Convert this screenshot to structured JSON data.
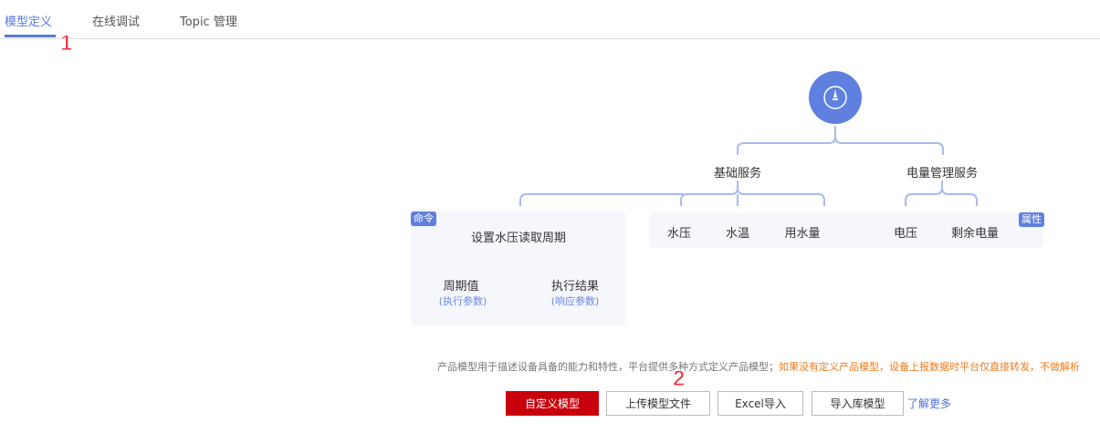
{
  "tabs": [
    {
      "label": "模型定义",
      "active": true
    },
    {
      "label": "在线调试"
    },
    {
      "label": "Topic 管理"
    }
  ],
  "annotations": [
    "1",
    "2"
  ],
  "diagram": {
    "root_icon": "compass-icon",
    "services": [
      "基础服务",
      "电量管理服务"
    ],
    "command": {
      "tag": "命令",
      "name": "设置水压读取周期",
      "params": [
        {
          "name": "周期值",
          "type": "(执行参数)"
        },
        {
          "name": "执行结果",
          "type": "(响应参数)"
        }
      ]
    },
    "properties": {
      "tag": "属性",
      "items": [
        "水压",
        "水温",
        "用水量",
        "电压",
        "剩余电量"
      ]
    }
  },
  "description": {
    "normal": "产品模型用于描述设备具备的能力和特性，平台提供多种方式定义产品模型；",
    "warning": "如果没有定义产品模型，设备上报数据时平台仅直接转发，不做解析"
  },
  "buttons": {
    "custom": "自定义模型",
    "upload": "上传模型文件",
    "excel": "Excel导入",
    "library": "导入库模型",
    "learn_more": "了解更多"
  },
  "colors": {
    "accent": "#5a78d8",
    "primary_button": "#c7000b",
    "warning": "#f07b1c"
  }
}
